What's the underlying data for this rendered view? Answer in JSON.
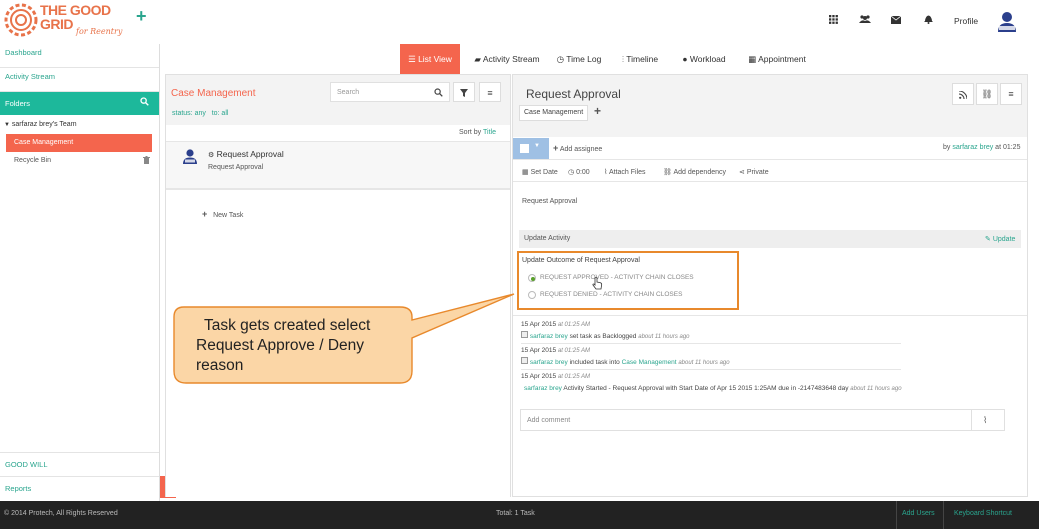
{
  "header": {
    "logo_line1": "THE GOOD",
    "logo_line2": "GRID",
    "logo_tagline": "for Reentry",
    "add_icon": "plus-icon",
    "icons": [
      "grid-icon",
      "users-icon",
      "envelope-icon",
      "bell-icon"
    ],
    "profile_label": "Profile"
  },
  "sidebar": {
    "dashboard": "Dashboard",
    "activity_stream": "Activity Stream",
    "folders": "Folders",
    "team": "sarfaraz brey's Team",
    "case_management": "Case Management",
    "recycle_bin": "Recycle Bin",
    "good_will": "GOOD WILL",
    "reports": "Reports"
  },
  "tabs": [
    {
      "label": "List View",
      "icon": "list-icon"
    },
    {
      "label": "Activity Stream",
      "icon": "comment-icon"
    },
    {
      "label": "Time Log",
      "icon": "clock-icon"
    },
    {
      "label": "Timeline",
      "icon": "timeline-icon"
    },
    {
      "label": "Workload",
      "icon": "user-icon"
    },
    {
      "label": "Appointment",
      "icon": "calendar-icon"
    }
  ],
  "list": {
    "title": "Case Management",
    "search_placeholder": "Search",
    "status_label": "status: any",
    "to_label": "to: all",
    "sort_prefix": "Sort by",
    "sort_field": "Title",
    "task_title": "Request Approval",
    "task_subtitle": "Request Approval",
    "new_task": "New Task"
  },
  "detail": {
    "title": "Request Approval",
    "folder_tag": "Case Management",
    "add_assignee": "Add assignee",
    "by_prefix": "by",
    "by_user": "sarfaraz brey",
    "by_time": "at 01:25",
    "set_date": "Set Date",
    "time_value": "0:00",
    "attach_files": "Attach Files",
    "add_dependency": "Add dependency",
    "private": "Private",
    "description": "Request Approval",
    "update_activity": "Update Activity",
    "update_link": "Update",
    "outcome_title": "Update Outcome of Request Approval",
    "option_approved": "REQUEST APPROVED - ACTIVITY CHAIN CLOSES",
    "option_denied": "REQUEST DENIED - ACTIVITY CHAIN CLOSES",
    "add_comment_placeholder": "Add comment"
  },
  "activity_log": [
    {
      "date": "15 Apr 2015",
      "time": "at 01:25 AM",
      "user": "sarfaraz brey",
      "text": "set task as Backlogged",
      "ago": "about 11 hours ago"
    },
    {
      "date": "15 Apr 2015",
      "time": "at 01:25 AM",
      "user": "sarfaraz brey",
      "text": "included task into",
      "link": "Case Management",
      "ago": "about 11 hours ago"
    },
    {
      "date": "15 Apr 2015",
      "time": "at 01:25 AM",
      "user": "sarfaraz brey",
      "text": "Activity Started - Request Approval with Start Date of Apr 15 2015 1:25AM due in -2147483648 day",
      "ago": "about 11 hours ago"
    }
  ],
  "callout": {
    "line1": "Task gets created select",
    "line2": "Request Approve / Deny",
    "line3": "reason"
  },
  "footer": {
    "copyright": "© 2014 Protech, All Rights Reserved",
    "total": "Total: 1 Task",
    "add_users": "Add Users",
    "keyboard_shortcut": "Keyboard Shortcut"
  },
  "colors": {
    "accent": "#f4654d",
    "teal": "#2aa58e",
    "callout_border": "#e8892c",
    "footer_bg": "#222222"
  }
}
